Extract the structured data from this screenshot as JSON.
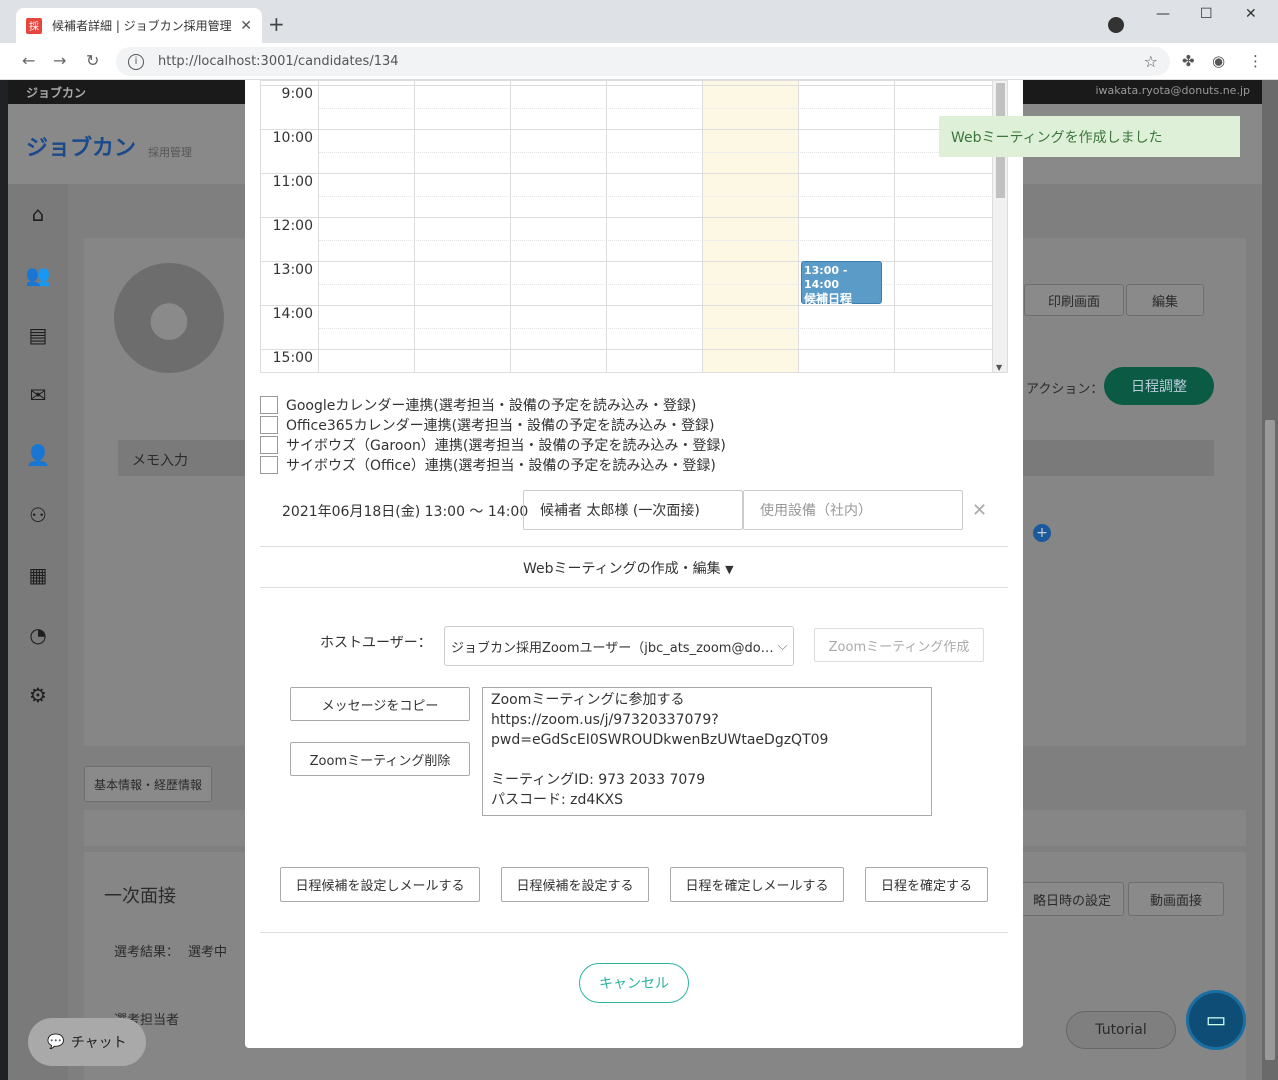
{
  "browser": {
    "tab_title": "候補者詳細 | ジョブカン採用管理",
    "favicon_text": "採",
    "url": "http://localhost:3001/candidates/134"
  },
  "app": {
    "brand": "ジョブカン",
    "user_email": "iwakata.ryota@donuts.ne.jp",
    "logo": "ジョブカン",
    "logo_sub": "採用管理",
    "print_button": "印刷画面",
    "edit_button": "編集",
    "action_label": "アクション：",
    "schedule_button": "日程調整",
    "memo_label": "メモ入力",
    "basic_info_tab": "基本情報・経歴情報",
    "interview_title": "一次面接",
    "selection_result_label": "選考結果：",
    "selection_result_value": "選考中",
    "selector_label": "選考担当者",
    "skip_date_button": "略日時の設定",
    "video_interview_button": "動画面接",
    "tutorial_button": "Tutorial",
    "chat_button": "チャット"
  },
  "calendar": {
    "times": [
      "9:00",
      "10:00",
      "11:00",
      "12:00",
      "13:00",
      "14:00",
      "15:00"
    ],
    "event_time": "13:00 - 14:00",
    "event_title": "候補日程"
  },
  "integrations": [
    "Googleカレンダー連携(選考担当・設備の予定を読み込み・登録)",
    "Office365カレンダー連携(選考担当・設備の予定を読み込み・登録)",
    "サイボウズ（Garoon）連携(選考担当・設備の予定を読み込み・登録)",
    "サイボウズ（Office）連携(選考担当・設備の予定を読み込み・登録)"
  ],
  "slot": {
    "datetime": "2021年06月18日(金) 13:00 〜 14:00",
    "title_value": "候補者 太郎様 (一次面接)",
    "equipment_placeholder": "使用設備（社内）"
  },
  "web_meeting": {
    "toggle_label": "Webミーティングの作成・編集",
    "host_label": "ホストユーザー：",
    "host_value": "ジョブカン採用Zoomユーザー（jbc_ats_zoom@do…",
    "create_button": "Zoomミーティング作成",
    "copy_button": "メッセージをコピー",
    "delete_button": "Zoomミーティング削除",
    "message": "Zoomミーティングに参加する\nhttps://zoom.us/j/97320337079?\npwd=eGdScEI0SWROUDkwenBzUWtaeDgzQT09\n\nミーティングID: 973 2033 7079\nパスコード: zd4KXS"
  },
  "actions": {
    "set_candidates_mail": "日程候補を設定しメールする",
    "set_candidates": "日程候補を設定する",
    "confirm_mail": "日程を確定しメールする",
    "confirm": "日程を確定する",
    "cancel": "キャンセル"
  },
  "toast": "Webミーティングを作成しました"
}
